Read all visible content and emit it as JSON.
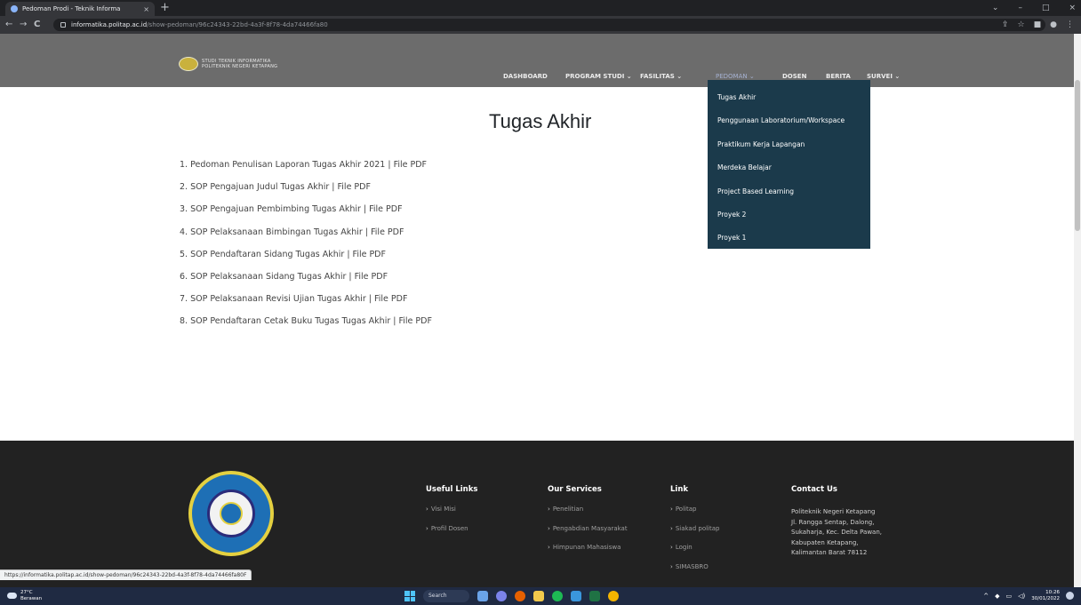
{
  "browser": {
    "tab_title": "Pedoman Prodi - Teknik Informa",
    "tab_close": "×",
    "new_tab": "+",
    "win_min": "–",
    "win_max": "□",
    "win_close": "×",
    "win_menu": "⌄",
    "back": "←",
    "forward": "→",
    "reload": "C",
    "url_host": "informatika.politap.ac.id",
    "url_path": "/show-pedoman/96c24343-22bd-4a3f-8f78-4da74466fa80",
    "status_url": "https://informatika.politap.ac.id/show-pedoman/96c24343-22bd-4a3f-8f78-4da74466fa80F"
  },
  "header": {
    "logo_line1": "STUDI TEKNIK INFORMATIKA",
    "logo_line2": "POLITEKNIK NEGERI KETAPANG"
  },
  "nav": {
    "items": [
      "DASHBOARD",
      "PROGRAM STUDI ⌄",
      "FASILITAS ⌄",
      "PEDOMAN ⌄",
      "DOSEN",
      "BERITA",
      "SURVEI ⌄"
    ],
    "active_index": 3
  },
  "dropdown": {
    "items": [
      "Tugas Akhir",
      "Penggunaan Laboratorium/Workspace",
      "Praktikum Kerja Lapangan",
      "Merdeka Belajar",
      "Project Based Learning",
      "Proyek 2",
      "Proyek 1"
    ]
  },
  "main": {
    "title": "Tugas Akhir",
    "documents": [
      "1. Pedoman Penulisan Laporan Tugas Akhir 2021 | File PDF",
      "2. SOP Pengajuan Judul Tugas Akhir | File PDF",
      "3. SOP Pengajuan Pembimbing Tugas Akhir | File PDF",
      "4. SOP Pelaksanaan Bimbingan Tugas Akhir | File PDF",
      "5. SOP Pendaftaran Sidang Tugas Akhir | File PDF",
      "6. SOP Pelaksanaan Sidang Tugas Akhir | File PDF",
      "7. SOP Pelaksanaan Revisi Ujian Tugas Akhir | File PDF",
      "8. SOP Pendaftaran Cetak Buku Tugas Tugas Akhir | File PDF"
    ]
  },
  "footer": {
    "useful_links": {
      "heading": "Useful Links",
      "items": [
        "Visi Misi",
        "Profil Dosen"
      ]
    },
    "services": {
      "heading": "Our Services",
      "items": [
        "Penelitian",
        "Pengabdian Masyarakat",
        "Himpunan Mahasiswa"
      ]
    },
    "link": {
      "heading": "Link",
      "items": [
        "Politap",
        "Siakad politap",
        "Login",
        "SIMASBRO"
      ]
    },
    "contact": {
      "heading": "Contact Us",
      "lines": [
        "Politeknik Negeri Ketapang",
        "Jl. Rangga Sentap, Dalong,",
        "Sukaharja, Kec. Delta Pawan,",
        "Kabupaten Ketapang,",
        "Kalimantan Barat 78112"
      ]
    }
  },
  "taskbar": {
    "temperature": "27°C",
    "weather_desc": "Berawan",
    "search": "Search",
    "time": "10:26",
    "date": "30/01/2022"
  },
  "colors": {
    "nav_bg": "#6c6c6c",
    "dropdown_bg": "#1b3a4b",
    "footer_bg": "#222222",
    "taskbar_bg": "#1f2a42"
  }
}
